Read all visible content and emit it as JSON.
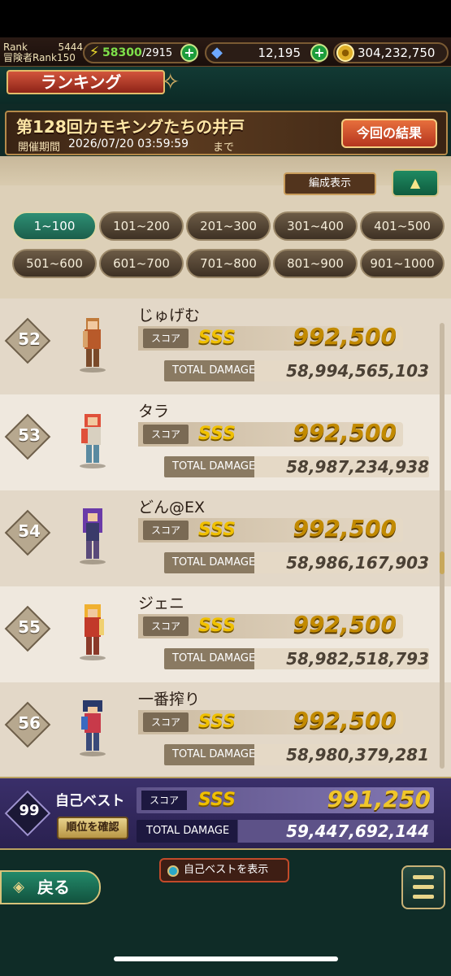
{
  "header": {
    "rank_label": "Rank",
    "rank_value": "5444",
    "adventurer_label": "冒険者Rank150",
    "stamina_current": "58300",
    "stamina_max": "/2915",
    "gems": "12,195",
    "gold": "304,232,750"
  },
  "title": "ランキング",
  "event": {
    "name": "第128回カモキングたちの井戸",
    "period_label": "開催期間",
    "period_value": "2026/07/20 03:59:59",
    "period_suffix": "まで",
    "results_button": "今回の結果"
  },
  "controls": {
    "formation_button": "編成表示",
    "toggle_symbol": "▲"
  },
  "ranges": [
    "1~100",
    "101~200",
    "201~300",
    "301~400",
    "401~500",
    "501~600",
    "601~700",
    "701~800",
    "801~900",
    "901~1000"
  ],
  "active_range": "1~100",
  "labels": {
    "score": "スコア",
    "total_damage": "TOTAL DAMAGE",
    "sss": "SSS"
  },
  "rankings": [
    {
      "rank": "52",
      "name": "じゅげむ",
      "score": "992,500",
      "damage": "58,994,565,103"
    },
    {
      "rank": "53",
      "name": "タラ",
      "score": "992,500",
      "damage": "58,987,234,938"
    },
    {
      "rank": "54",
      "name": "どん@EX",
      "score": "992,500",
      "damage": "58,986,167,903"
    },
    {
      "rank": "55",
      "name": "ジェニ",
      "score": "992,500",
      "damage": "58,982,518,793"
    },
    {
      "rank": "56",
      "name": "一番搾り",
      "score": "992,500",
      "damage": "58,980,379,281"
    }
  ],
  "self_best": {
    "rank": "99",
    "label": "自己ベスト",
    "confirm_button": "順位を確認",
    "score": "991,250",
    "damage": "59,447,692,144"
  },
  "footer": {
    "show_self_button": "自己ベストを表示",
    "back_button": "戻る"
  },
  "colors": {
    "accent_green": "#1f8a62",
    "gold_text": "#c28a00",
    "self_best_bg": "#3a2f6a",
    "results_orange": "#e76f3c"
  }
}
